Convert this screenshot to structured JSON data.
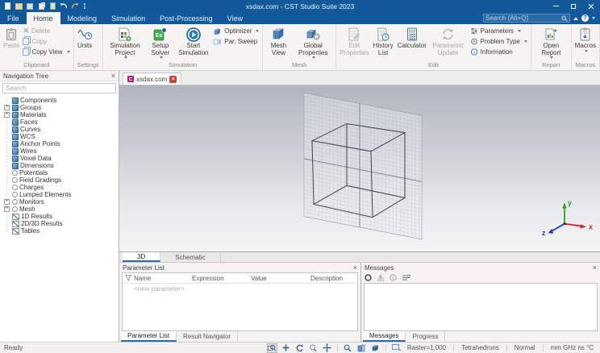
{
  "colors": {
    "titlebar": "#11599a",
    "accent": "#2b6cb8",
    "axis_x": "#cc2a1e",
    "axis_y": "#27a327",
    "axis_z": "#2438c8",
    "tab_icon": "#c2187e",
    "close_badge": "#cf4334"
  },
  "titlebar": {
    "title": "xsdax.com - CST Studio Suite 2023"
  },
  "menu": {
    "tabs": [
      {
        "label": "File"
      },
      {
        "label": "Home"
      },
      {
        "label": "Modeling"
      },
      {
        "label": "Simulation"
      },
      {
        "label": "Post-Processing"
      },
      {
        "label": "View"
      }
    ],
    "active": "Home",
    "search_placeholder": "Search (Alt+Q)"
  },
  "ribbon": {
    "groups": [
      {
        "label": "Clipboard",
        "buttons": {
          "paste": "Paste",
          "delete": "Delete",
          "copy": "Copy",
          "copy_view": "Copy View"
        }
      },
      {
        "label": "Settings",
        "buttons": {
          "units": "Units"
        }
      },
      {
        "label": "Simulation",
        "buttons": {
          "simulation_project": "Simulation Project",
          "setup_solver": "Setup Solver",
          "start_simulation": "Start Simulation",
          "optimizer": "Optimizer",
          "par_sweep": "Par. Sweep"
        }
      },
      {
        "label": "Mesh",
        "buttons": {
          "mesh_view": "Mesh View",
          "global_properties": "Global Properties"
        }
      },
      {
        "label": "Edit",
        "buttons": {
          "edit_properties": "Edit Properties",
          "history_list": "History List",
          "calculator": "Calculator",
          "parametric_update": "Parametric Update",
          "parameters": "Parameters",
          "problem_type": "Problem Type",
          "information": "Information"
        }
      },
      {
        "label": "Report",
        "buttons": {
          "open_report": "Open Report"
        }
      },
      {
        "label": "Macros",
        "buttons": {
          "macros": "Macros"
        }
      }
    ]
  },
  "nav_tree": {
    "title": "Navigation Tree",
    "search_placeholder": "Search",
    "items": [
      {
        "label": "Components"
      },
      {
        "label": "Groups"
      },
      {
        "label": "Materials"
      },
      {
        "label": "Faces"
      },
      {
        "label": "Curves"
      },
      {
        "label": "WCS"
      },
      {
        "label": "Anchor Points"
      },
      {
        "label": "Wires"
      },
      {
        "label": "Voxel Data"
      },
      {
        "label": "Dimensions"
      },
      {
        "label": "Potentials"
      },
      {
        "label": "Field Gradings"
      },
      {
        "label": "Charges"
      },
      {
        "label": "Lumped Elements"
      },
      {
        "label": "Monitors"
      },
      {
        "label": "Mesh"
      },
      {
        "label": "1D Results"
      },
      {
        "label": "2D/3D Results"
      },
      {
        "label": "Tables"
      }
    ]
  },
  "document_tab": {
    "label": "xsdax.com"
  },
  "viewport": {
    "axis_labels": {
      "x": "x",
      "y": "y",
      "z": "z"
    }
  },
  "view_tabs": {
    "t3d": "3D",
    "schematic": "Schematic"
  },
  "parameter_panel": {
    "title": "Parameter List",
    "columns": {
      "name": "Name",
      "expression": "Expression",
      "value": "Value",
      "description": "Description"
    },
    "new_row": "<new parameter>",
    "tabs": {
      "parameter_list": "Parameter List",
      "result_navigator": "Result Navigator"
    }
  },
  "messages_panel": {
    "title": "Messages",
    "tabs": {
      "messages": "Messages",
      "progress": "Progress"
    }
  },
  "status_bar": {
    "ready": "Ready",
    "raster": "Raster=1.000",
    "cells": "Tetrahedrons",
    "mode": "Normal",
    "units": "mm GHz ns °C"
  }
}
